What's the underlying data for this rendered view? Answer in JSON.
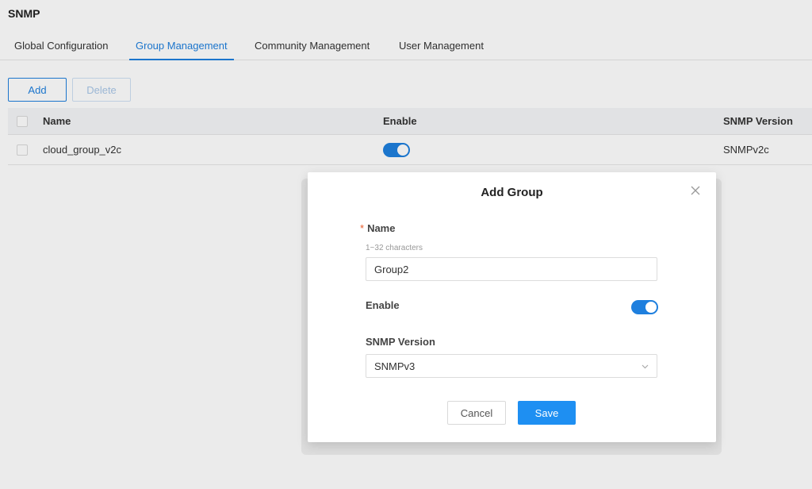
{
  "header": {
    "title": "SNMP"
  },
  "tabs": [
    {
      "label": "Global Configuration"
    },
    {
      "label": "Group Management"
    },
    {
      "label": "Community Management"
    },
    {
      "label": "User Management"
    }
  ],
  "toolbar": {
    "add_label": "Add",
    "delete_label": "Delete"
  },
  "table": {
    "columns": [
      "Name",
      "Enable",
      "SNMP Version"
    ],
    "rows": [
      {
        "name": "cloud_group_v2c",
        "enable": true,
        "snmp_version": "SNMPv2c"
      }
    ]
  },
  "modal": {
    "title": "Add Group",
    "name_label": "Name",
    "required_mark": "*",
    "name_hint": "1~32 characters",
    "name_value": "Group2",
    "enable_label": "Enable",
    "enable_value": true,
    "version_label": "SNMP Version",
    "version_value": "SNMPv3",
    "cancel_label": "Cancel",
    "save_label": "Save"
  },
  "colors": {
    "accent": "#1e7fde",
    "save_button": "#1e8ff2",
    "required": "#e85c2b"
  },
  "icons": {
    "close": "close-icon",
    "dropdown": "chevron-down-icon"
  }
}
